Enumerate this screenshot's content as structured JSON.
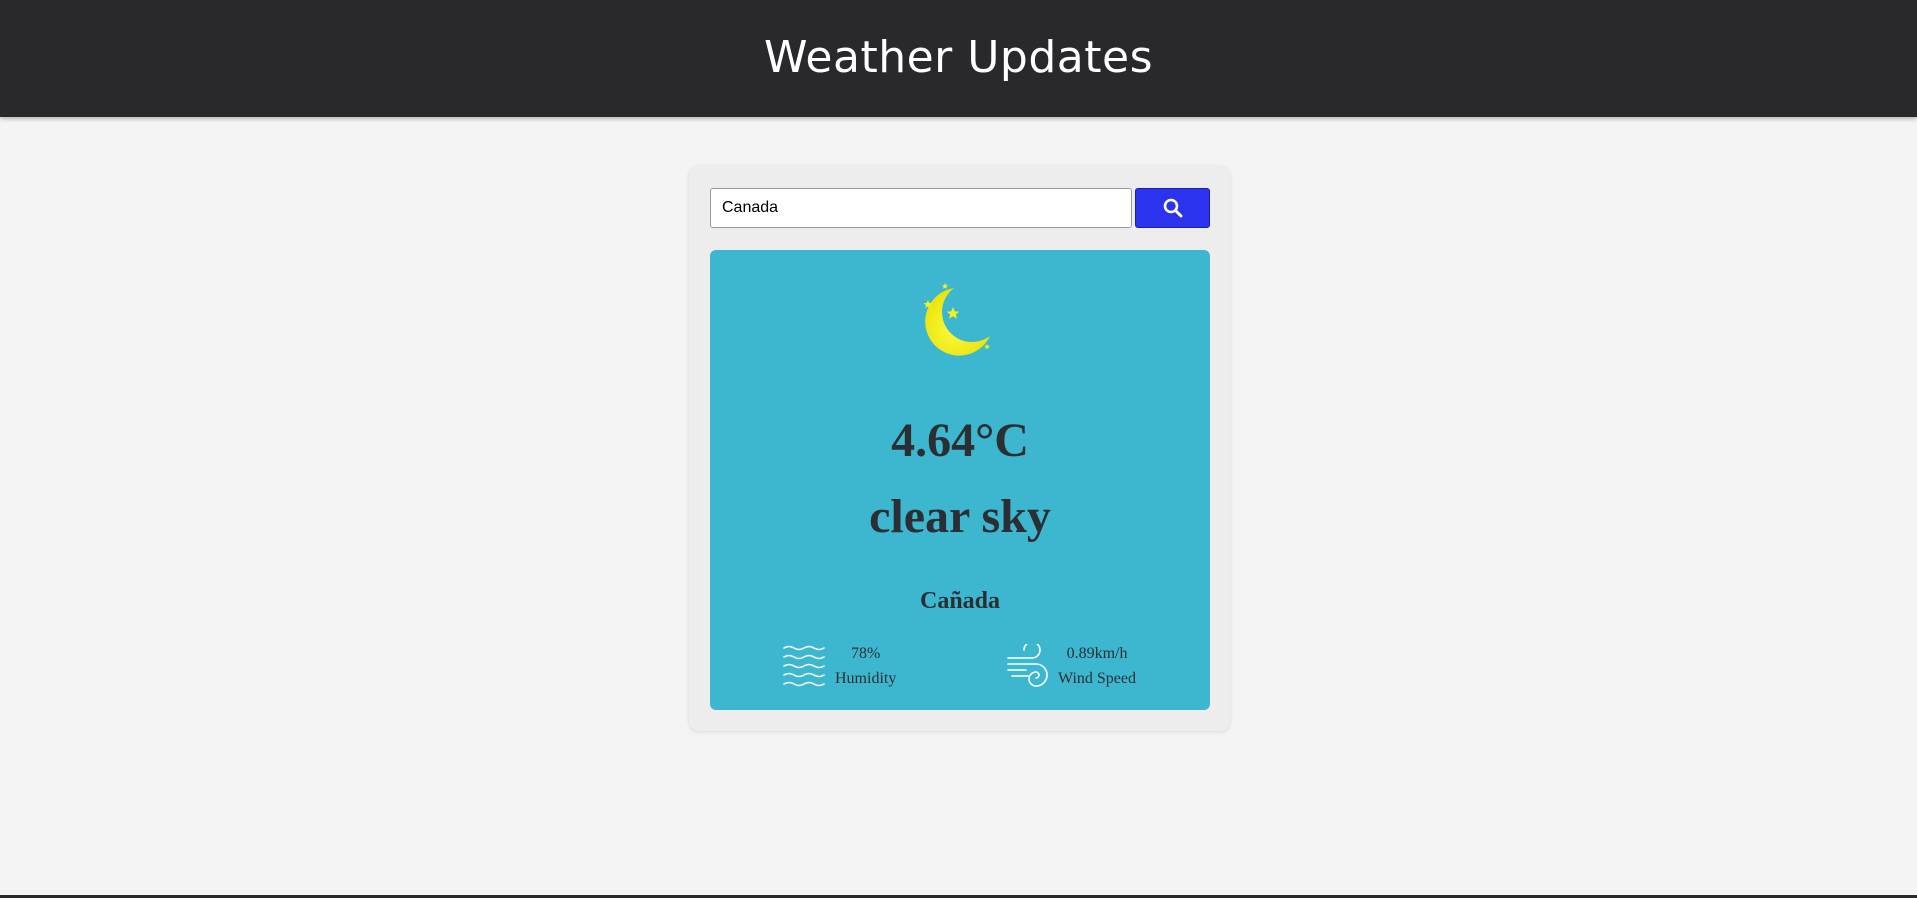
{
  "header": {
    "title": "Weather Updates"
  },
  "search": {
    "value": "Canada",
    "placeholder": "",
    "button_icon": "search-icon"
  },
  "weather": {
    "icon": "moon-stars-icon",
    "temperature": "4.64°C",
    "description": "clear sky",
    "city": "Cañada",
    "humidity": {
      "icon": "waves-icon",
      "value": "78%",
      "label": "Humidity"
    },
    "wind": {
      "icon": "wind-icon",
      "value": "0.89km/h",
      "label": "Wind Speed"
    }
  },
  "colors": {
    "header_bg": "#28282d",
    "page_bg": "#f4f4f4",
    "card_bg": "#3db7cf",
    "button_bg": "#2c33ef",
    "moon": "#f5f21a"
  }
}
